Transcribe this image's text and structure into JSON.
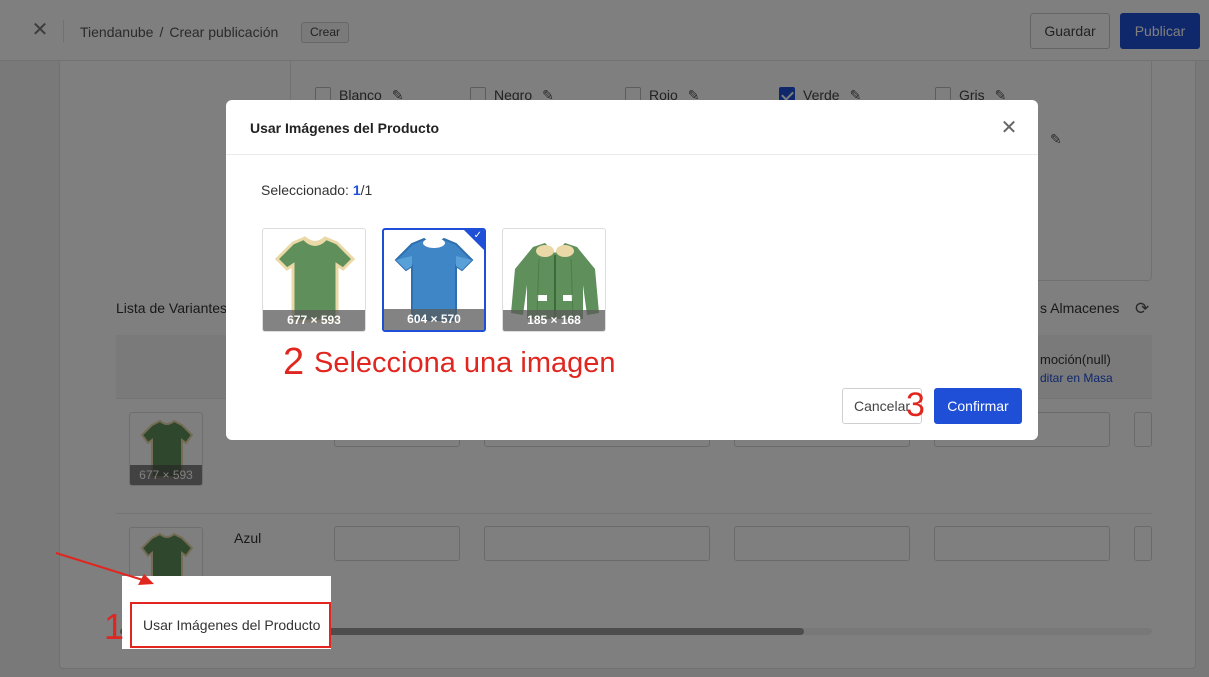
{
  "header": {
    "breadcrumb_root": "Tiendanube",
    "breadcrumb_sep": "/",
    "breadcrumb_page": "Crear publicación",
    "tag": "Crear",
    "save_label": "Guardar",
    "publish_label": "Publicar"
  },
  "colors": {
    "options": [
      {
        "label": "Blanco",
        "checked": false
      },
      {
        "label": "Negro",
        "checked": false
      },
      {
        "label": "Rojo",
        "checked": false
      },
      {
        "label": "Verde",
        "checked": true
      },
      {
        "label": "Gris",
        "checked": false
      }
    ]
  },
  "variants": {
    "title": "Lista de Variantes",
    "warehouses_label": "s Almacenes",
    "promo_header": "moción(null)",
    "bulk_edit_link": "ditar en Masa",
    "row1_thumb_dims": "677 × 593",
    "row2_name": "Azul"
  },
  "popup_menu": {
    "item_label": "Usar Imágenes del Producto"
  },
  "modal": {
    "title": "Usar Imágenes del Producto",
    "selected_label": "Seleccionado: ",
    "selected_count": "1",
    "selected_total": "/1",
    "images": [
      {
        "dims": "677 × 593",
        "selected": false,
        "icon": "green-tshirt-image"
      },
      {
        "dims": "604 × 570",
        "selected": true,
        "icon": "blue-tshirt-image"
      },
      {
        "dims": "185 × 168",
        "selected": false,
        "icon": "green-cardigan-image"
      }
    ],
    "cancel_label": "Cancelar",
    "confirm_label": "Confirmar"
  },
  "annotations": {
    "step1": "1",
    "step2": "2",
    "step2_text": "Selecciona una imagen",
    "step3": "3"
  },
  "theme": {
    "accent": "#1f4fd6",
    "annotation_red": "#e0261f"
  }
}
